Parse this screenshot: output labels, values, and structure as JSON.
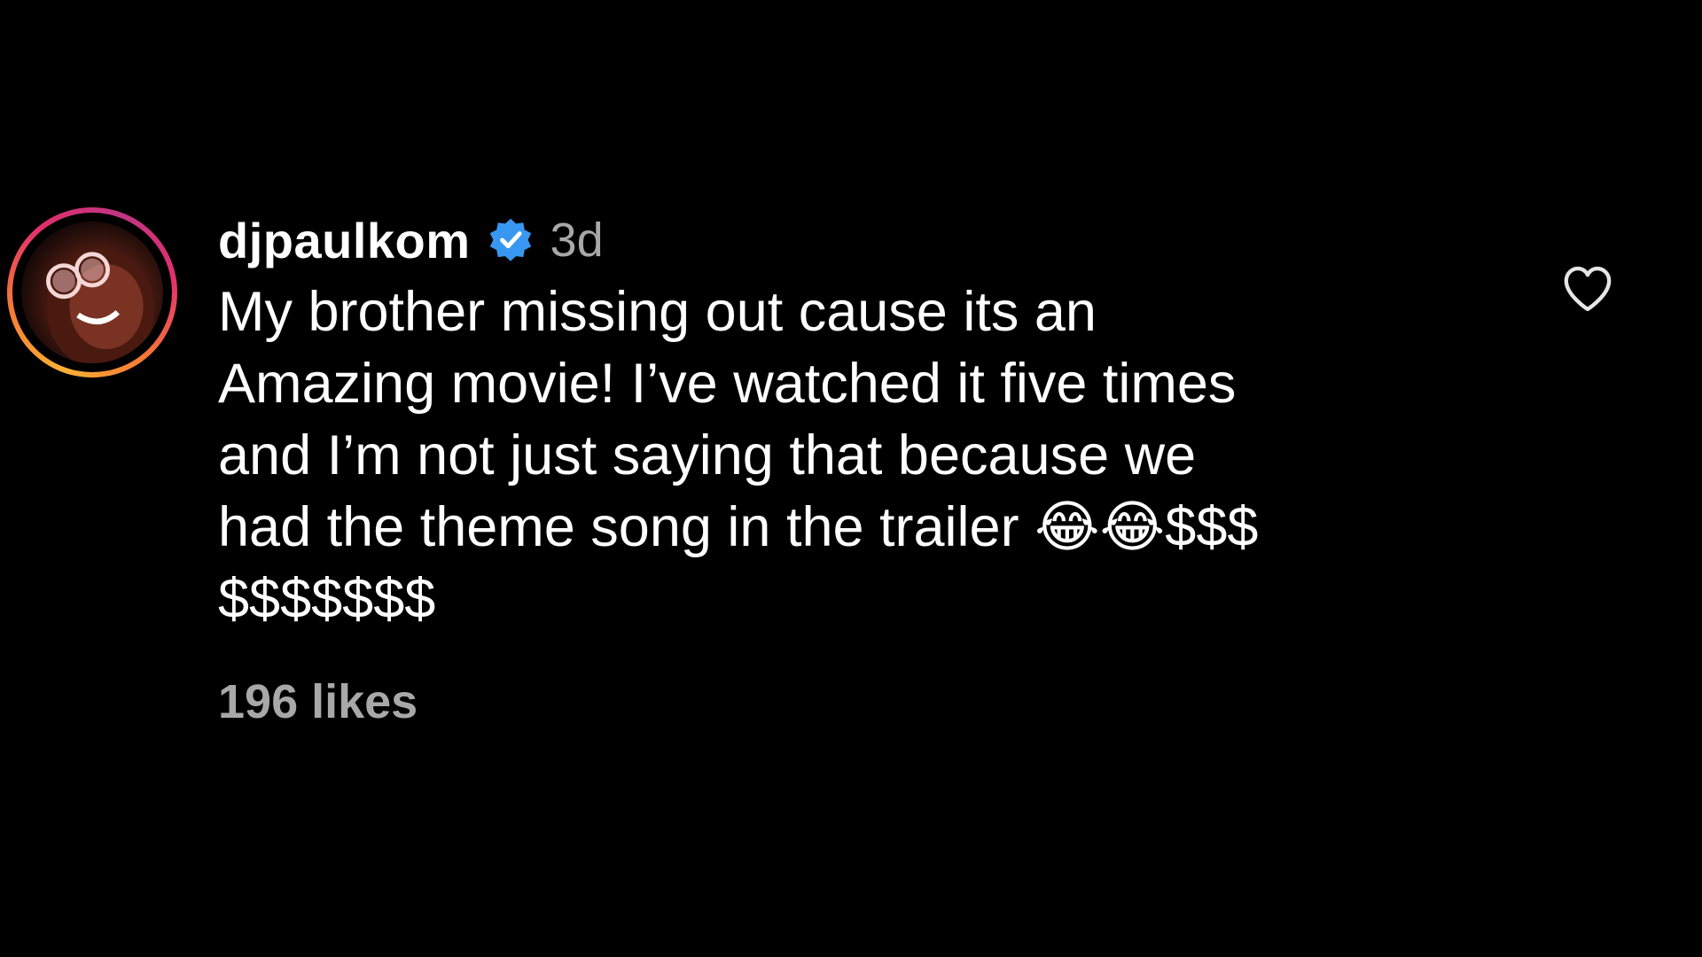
{
  "comment": {
    "username": "djpaulkom",
    "verified_icon": "verified-badge-icon",
    "timestamp": "3d",
    "text": "My brother missing out cause its an\nAmazing movie! I’ve watched it five times\nand I’m not just saying that because we\nhad the theme song in the trailer 😂😂$$$\n$$$$$$$",
    "likes": "196 likes",
    "like_icon": "heart-outline-icon",
    "avatar_icon": "profile-avatar"
  },
  "colors": {
    "background": "#000000",
    "text": "#ffffff",
    "secondary_text": "#a8a8a8",
    "verified_blue": "#3897f0"
  }
}
